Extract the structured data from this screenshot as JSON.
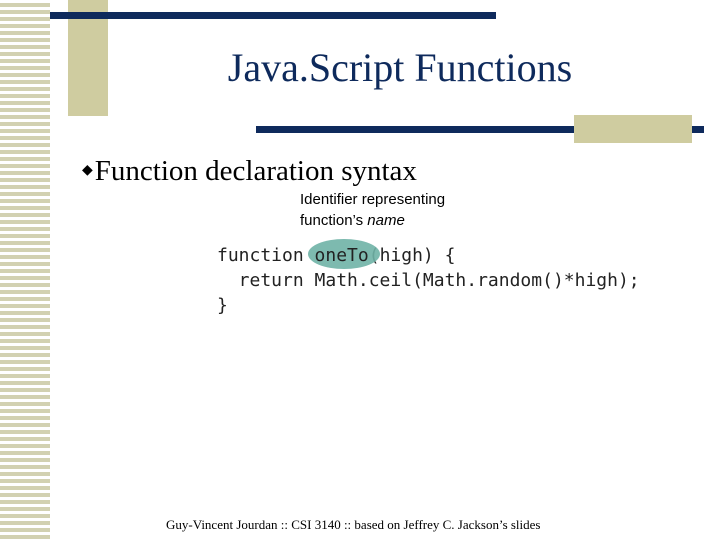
{
  "slide": {
    "title": "Java.Script Functions",
    "bullet": "Function declaration syntax",
    "annotation_line1": "Identifier representing",
    "annotation_line2_plain": "function’s ",
    "annotation_line2_italic": "name",
    "code": {
      "line1_before": "function ",
      "line1_identifier": "oneTo",
      "line1_after": "(high) {",
      "line2": "  return Math.ceil(Math.random()*high);",
      "line3": "}"
    },
    "footer": "Guy-Vincent Jourdan :: CSI 3140 :: based on Jeffrey C. Jackson’s slides"
  },
  "colors": {
    "title": "#0e2a5c",
    "accent_line": "#0e2a5c",
    "accent_block": "#cfcca0",
    "highlight": "#6fb3a6"
  }
}
